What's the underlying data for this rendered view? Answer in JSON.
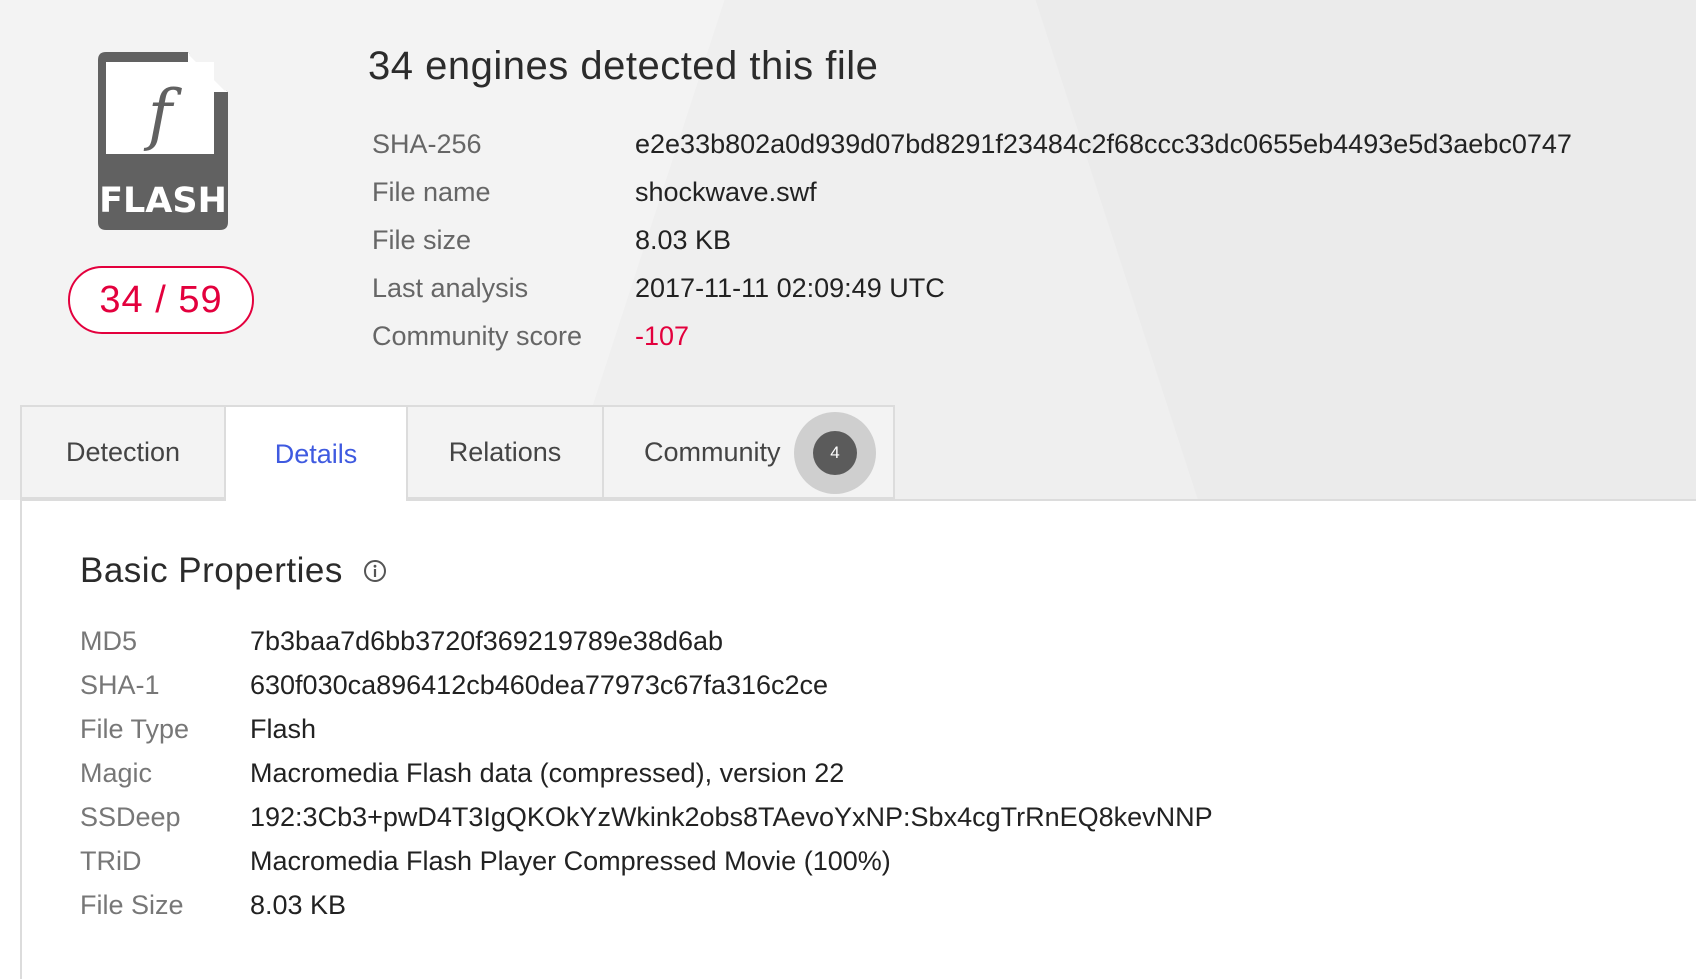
{
  "file_type_icon": {
    "label": "FLASH",
    "glyph": "f",
    "color": "#616161"
  },
  "score": "34 / 59",
  "title": "34 engines detected this file",
  "summary": [
    {
      "label": "SHA-256",
      "value": "e2e33b802a0d939d07bd8291f23484c2f68ccc33dc0655eb4493e5d3aebc0747"
    },
    {
      "label": "File name",
      "value": "shockwave.swf"
    },
    {
      "label": "File size",
      "value": "8.03 KB"
    },
    {
      "label": "Last analysis",
      "value": "2017-11-11 02:09:49 UTC"
    },
    {
      "label": "Community score",
      "value": "-107"
    }
  ],
  "tabs": [
    {
      "label": "Detection"
    },
    {
      "label": "Details"
    },
    {
      "label": "Relations"
    },
    {
      "label": "Community",
      "badge": "4"
    }
  ],
  "active_tab": "Details",
  "basic_properties": {
    "title": "Basic Properties",
    "rows": [
      {
        "label": "MD5",
        "value": "7b3baa7d6bb3720f369219789e38d6ab"
      },
      {
        "label": "SHA-1",
        "value": "630f030ca896412cb460dea77973c67fa316c2ce"
      },
      {
        "label": "File Type",
        "value": "Flash"
      },
      {
        "label": "Magic",
        "value": "Macromedia Flash data (compressed), version 22"
      },
      {
        "label": "SSDeep",
        "value": "192:3Cb3+pwD4T3IgQKOkYzWkink2obs8TAevoYxNP:Sbx4cgTrRnEQ8kevNNP"
      },
      {
        "label": "TRiD",
        "value": "Macromedia Flash Player Compressed Movie (100%)"
      },
      {
        "label": "File Size",
        "value": "8.03 KB"
      }
    ]
  },
  "colors": {
    "malicious": "#e3003d",
    "active_tab": "#3f5ae0",
    "header_bg": "#f3f3f3"
  }
}
